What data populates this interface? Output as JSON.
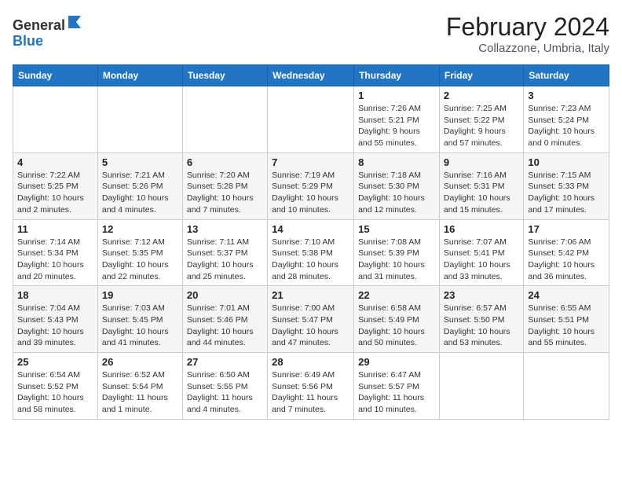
{
  "header": {
    "logo": {
      "general": "General",
      "blue": "Blue"
    },
    "title": "February 2024",
    "subtitle": "Collazzone, Umbria, Italy"
  },
  "weekdays": [
    "Sunday",
    "Monday",
    "Tuesday",
    "Wednesday",
    "Thursday",
    "Friday",
    "Saturday"
  ],
  "weeks": [
    [
      {
        "day": "",
        "info": ""
      },
      {
        "day": "",
        "info": ""
      },
      {
        "day": "",
        "info": ""
      },
      {
        "day": "",
        "info": ""
      },
      {
        "day": "1",
        "info": "Sunrise: 7:26 AM\nSunset: 5:21 PM\nDaylight: 9 hours\nand 55 minutes."
      },
      {
        "day": "2",
        "info": "Sunrise: 7:25 AM\nSunset: 5:22 PM\nDaylight: 9 hours\nand 57 minutes."
      },
      {
        "day": "3",
        "info": "Sunrise: 7:23 AM\nSunset: 5:24 PM\nDaylight: 10 hours\nand 0 minutes."
      }
    ],
    [
      {
        "day": "4",
        "info": "Sunrise: 7:22 AM\nSunset: 5:25 PM\nDaylight: 10 hours\nand 2 minutes."
      },
      {
        "day": "5",
        "info": "Sunrise: 7:21 AM\nSunset: 5:26 PM\nDaylight: 10 hours\nand 4 minutes."
      },
      {
        "day": "6",
        "info": "Sunrise: 7:20 AM\nSunset: 5:28 PM\nDaylight: 10 hours\nand 7 minutes."
      },
      {
        "day": "7",
        "info": "Sunrise: 7:19 AM\nSunset: 5:29 PM\nDaylight: 10 hours\nand 10 minutes."
      },
      {
        "day": "8",
        "info": "Sunrise: 7:18 AM\nSunset: 5:30 PM\nDaylight: 10 hours\nand 12 minutes."
      },
      {
        "day": "9",
        "info": "Sunrise: 7:16 AM\nSunset: 5:31 PM\nDaylight: 10 hours\nand 15 minutes."
      },
      {
        "day": "10",
        "info": "Sunrise: 7:15 AM\nSunset: 5:33 PM\nDaylight: 10 hours\nand 17 minutes."
      }
    ],
    [
      {
        "day": "11",
        "info": "Sunrise: 7:14 AM\nSunset: 5:34 PM\nDaylight: 10 hours\nand 20 minutes."
      },
      {
        "day": "12",
        "info": "Sunrise: 7:12 AM\nSunset: 5:35 PM\nDaylight: 10 hours\nand 22 minutes."
      },
      {
        "day": "13",
        "info": "Sunrise: 7:11 AM\nSunset: 5:37 PM\nDaylight: 10 hours\nand 25 minutes."
      },
      {
        "day": "14",
        "info": "Sunrise: 7:10 AM\nSunset: 5:38 PM\nDaylight: 10 hours\nand 28 minutes."
      },
      {
        "day": "15",
        "info": "Sunrise: 7:08 AM\nSunset: 5:39 PM\nDaylight: 10 hours\nand 31 minutes."
      },
      {
        "day": "16",
        "info": "Sunrise: 7:07 AM\nSunset: 5:41 PM\nDaylight: 10 hours\nand 33 minutes."
      },
      {
        "day": "17",
        "info": "Sunrise: 7:06 AM\nSunset: 5:42 PM\nDaylight: 10 hours\nand 36 minutes."
      }
    ],
    [
      {
        "day": "18",
        "info": "Sunrise: 7:04 AM\nSunset: 5:43 PM\nDaylight: 10 hours\nand 39 minutes."
      },
      {
        "day": "19",
        "info": "Sunrise: 7:03 AM\nSunset: 5:45 PM\nDaylight: 10 hours\nand 41 minutes."
      },
      {
        "day": "20",
        "info": "Sunrise: 7:01 AM\nSunset: 5:46 PM\nDaylight: 10 hours\nand 44 minutes."
      },
      {
        "day": "21",
        "info": "Sunrise: 7:00 AM\nSunset: 5:47 PM\nDaylight: 10 hours\nand 47 minutes."
      },
      {
        "day": "22",
        "info": "Sunrise: 6:58 AM\nSunset: 5:49 PM\nDaylight: 10 hours\nand 50 minutes."
      },
      {
        "day": "23",
        "info": "Sunrise: 6:57 AM\nSunset: 5:50 PM\nDaylight: 10 hours\nand 53 minutes."
      },
      {
        "day": "24",
        "info": "Sunrise: 6:55 AM\nSunset: 5:51 PM\nDaylight: 10 hours\nand 55 minutes."
      }
    ],
    [
      {
        "day": "25",
        "info": "Sunrise: 6:54 AM\nSunset: 5:52 PM\nDaylight: 10 hours\nand 58 minutes."
      },
      {
        "day": "26",
        "info": "Sunrise: 6:52 AM\nSunset: 5:54 PM\nDaylight: 11 hours\nand 1 minute."
      },
      {
        "day": "27",
        "info": "Sunrise: 6:50 AM\nSunset: 5:55 PM\nDaylight: 11 hours\nand 4 minutes."
      },
      {
        "day": "28",
        "info": "Sunrise: 6:49 AM\nSunset: 5:56 PM\nDaylight: 11 hours\nand 7 minutes."
      },
      {
        "day": "29",
        "info": "Sunrise: 6:47 AM\nSunset: 5:57 PM\nDaylight: 11 hours\nand 10 minutes."
      },
      {
        "day": "",
        "info": ""
      },
      {
        "day": "",
        "info": ""
      }
    ]
  ]
}
